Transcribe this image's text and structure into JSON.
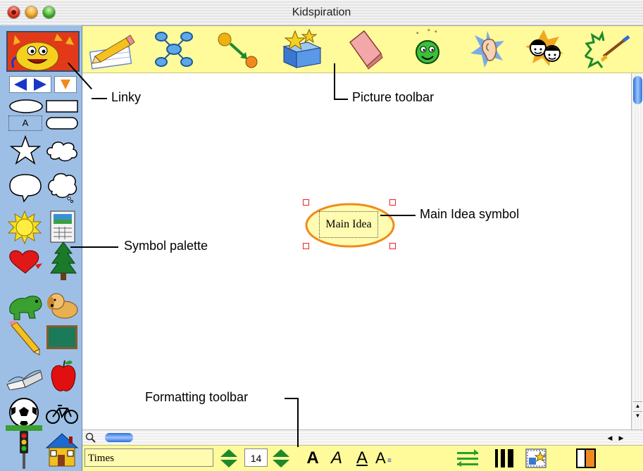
{
  "window": {
    "title": "Kidspiration"
  },
  "picture_toolbar": {
    "buttons": [
      {
        "name": "picture-view-icon"
      },
      {
        "name": "diagram-icon"
      },
      {
        "name": "link-icon"
      },
      {
        "name": "symbol-box-icon"
      },
      {
        "name": "eraser-icon"
      },
      {
        "name": "smiley-icon"
      },
      {
        "name": "listen-icon"
      },
      {
        "name": "people-icon"
      },
      {
        "name": "paint-icon"
      }
    ]
  },
  "formatting_toolbar": {
    "font": "Times",
    "size": "14",
    "bold_label": "A",
    "italic_label": "A",
    "underline_label": "A",
    "size_label": "A"
  },
  "canvas": {
    "main_idea_text": "Main Idea"
  },
  "callouts": {
    "linky": "Linky",
    "picture_toolbar": "Picture toolbar",
    "main_idea_symbol": "Main Idea symbol",
    "symbol_palette": "Symbol palette",
    "formatting_toolbar": "Formatting toolbar"
  },
  "palette": {
    "text_symbol_label": "A"
  },
  "colors": {
    "palette_bg": "#9dbfe6",
    "toolbar_bg": "#fffa9a",
    "accent_orange": "#f08a1e",
    "arrow_blue": "#1836c8",
    "arrow_green": "#1c8a2a"
  }
}
